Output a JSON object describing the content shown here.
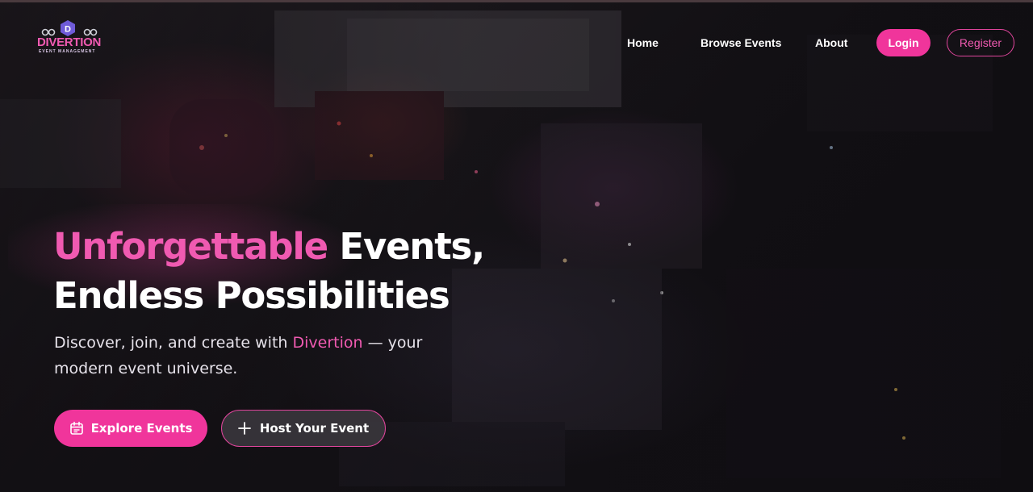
{
  "brand": {
    "logo_letter": "D",
    "logo_word": "DIVERTION",
    "logo_tagline": "EVENT MANAGEMENT",
    "accent_color": "#f0359b",
    "accent_text_color": "#f05ab1"
  },
  "nav": {
    "items": [
      {
        "label": "Home"
      },
      {
        "label": "Browse Events"
      },
      {
        "label": "About"
      }
    ],
    "login_label": "Login",
    "register_label": "Register"
  },
  "hero": {
    "headline_accent": "Unforgettable",
    "headline_rest_line1": " Events,",
    "headline_line2": "Endless Possibilities",
    "subhead_before": "Discover, join, and create with ",
    "subhead_brand": "Divertion",
    "subhead_after": " — your modern event universe.",
    "primary_button": {
      "label": "Explore Events",
      "icon": "calendar-icon"
    },
    "secondary_button": {
      "label": "Host Your Event",
      "icon": "plus-icon"
    }
  },
  "background": {
    "description_icon": "aerial-festival-photo"
  }
}
